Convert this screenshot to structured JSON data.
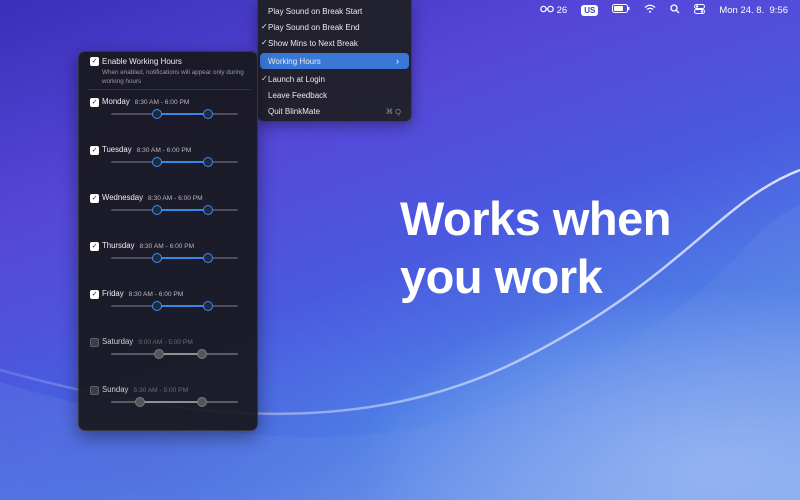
{
  "menubar": {
    "battery_text": "26",
    "input_source": "US",
    "datetime": "Mon 24. 8.  9:56"
  },
  "headline": {
    "line1": "Works when",
    "line2": "you work"
  },
  "app_menu": {
    "items": [
      {
        "label": "Play Sound on Break Start",
        "checked": false
      },
      {
        "label": "Play Sound on Break End",
        "checked": true
      },
      {
        "label": "Show Mins to Next Break",
        "checked": true
      },
      {
        "label": "Working Hours",
        "checked": false,
        "submenu": true
      },
      {
        "label": "Launch at Login",
        "checked": true
      },
      {
        "label": "Leave Feedback",
        "checked": false
      },
      {
        "label": "Quit BlinkMate",
        "checked": false,
        "shortcut": "⌘ Q"
      }
    ],
    "check_glyph": "✓",
    "submenu_glyph": "›"
  },
  "panel": {
    "enable_label": "Enable Working Hours",
    "enable_checked": true,
    "enable_description": "When enabled, notifications will appear only during working hours",
    "days": [
      {
        "name": "Monday",
        "hours": "8:30 AM - 6:00 PM",
        "enabled": true,
        "start_frac": 0.36,
        "end_frac": 0.76
      },
      {
        "name": "Tuesday",
        "hours": "8:30 AM - 6:00 PM",
        "enabled": true,
        "start_frac": 0.36,
        "end_frac": 0.76
      },
      {
        "name": "Wednesday",
        "hours": "8:30 AM - 6:00 PM",
        "enabled": true,
        "start_frac": 0.36,
        "end_frac": 0.76
      },
      {
        "name": "Thursday",
        "hours": "8:30 AM - 6:00 PM",
        "enabled": true,
        "start_frac": 0.36,
        "end_frac": 0.76
      },
      {
        "name": "Friday",
        "hours": "8:30 AM - 6:00 PM",
        "enabled": true,
        "start_frac": 0.36,
        "end_frac": 0.76
      },
      {
        "name": "Saturday",
        "hours": "9:00 AM - 5:00 PM",
        "enabled": false,
        "start_frac": 0.38,
        "end_frac": 0.72
      },
      {
        "name": "Sunday",
        "hours": "5:30 AM - 5:00 PM",
        "enabled": false,
        "start_frac": 0.23,
        "end_frac": 0.72
      }
    ]
  },
  "colors": {
    "accent": "#3a86e8",
    "menu_highlight": "#3a78d8"
  }
}
